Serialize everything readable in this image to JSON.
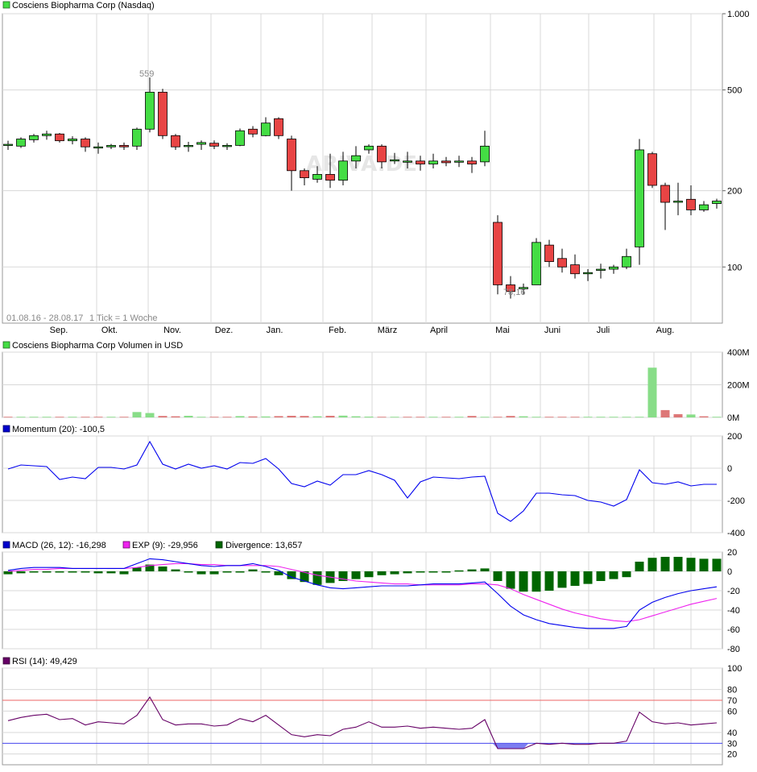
{
  "colors": {
    "up": "#44dd44",
    "down": "#e84444",
    "grid": "#d8d8d8",
    "momentum": "#0000ee",
    "macd": "#0000ee",
    "exp": "#ee22ee",
    "divergence": "#006600",
    "rsi": "#660066",
    "rsi_upper": "#ee6666",
    "rsi_lower": "#4444ee"
  },
  "header": {
    "price_title": "Cosciens Biopharma Corp (Nasdaq)",
    "volume_title": "Cosciens Biopharma Corp Volumen in USD"
  },
  "watermark": "ARIVA.DE",
  "price": {
    "range_label": "01.08.16 - 28.08.17",
    "tick_label": "1 Tick = 1 Woche",
    "high_annotation": "559",
    "low_annotation": "78,16",
    "y_ticks": [
      "1.000",
      "500",
      "200",
      "100"
    ],
    "x_months": [
      "Sep.",
      "Okt.",
      "Nov.",
      "Dez.",
      "Jan.",
      "Feb.",
      "März",
      "April",
      "Mai",
      "Juni",
      "Juli",
      "Aug."
    ]
  },
  "legends": {
    "momentum": {
      "label": "Momentum (20): -100,5"
    },
    "macd": {
      "label": "MACD (26, 12): -16,298"
    },
    "exp": {
      "label": "EXP (9): -29,956"
    },
    "divergence": {
      "label": "Divergence: 13,657"
    },
    "rsi": {
      "label": "RSI (14): 49,429"
    }
  },
  "chart_data": [
    {
      "type": "candlestick",
      "title": "Cosciens Biopharma Corp (Nasdaq)",
      "scale": "log",
      "ylim": [
        60,
        1000
      ],
      "y_ticks": [
        1000,
        500,
        200,
        100
      ],
      "candles": [
        [
          305,
          305,
          290,
          315
        ],
        [
          300,
          320,
          295,
          325
        ],
        [
          318,
          330,
          310,
          335
        ],
        [
          330,
          335,
          318,
          345
        ],
        [
          335,
          315,
          310,
          338
        ],
        [
          315,
          320,
          305,
          328
        ],
        [
          320,
          298,
          285,
          325
        ],
        [
          298,
          298,
          280,
          310
        ],
        [
          298,
          302,
          292,
          306
        ],
        [
          302,
          298,
          290,
          310
        ],
        [
          300,
          350,
          290,
          355
        ],
        [
          350,
          490,
          340,
          560
        ],
        [
          490,
          330,
          320,
          505
        ],
        [
          330,
          298,
          290,
          335
        ],
        [
          300,
          302,
          285,
          312
        ],
        [
          305,
          310,
          290,
          316
        ],
        [
          308,
          300,
          292,
          316
        ],
        [
          302,
          302,
          290,
          308
        ],
        [
          302,
          345,
          300,
          352
        ],
        [
          350,
          335,
          325,
          360
        ],
        [
          330,
          370,
          328,
          390
        ],
        [
          385,
          330,
          320,
          390
        ],
        [
          320,
          240,
          200,
          330
        ],
        [
          240,
          225,
          210,
          245
        ],
        [
          222,
          232,
          215,
          250
        ],
        [
          232,
          220,
          205,
          280
        ],
        [
          220,
          262,
          210,
          285
        ],
        [
          262,
          275,
          245,
          300
        ],
        [
          290,
          300,
          280,
          305
        ],
        [
          300,
          260,
          245,
          305
        ],
        [
          262,
          265,
          255,
          282
        ],
        [
          260,
          262,
          245,
          285
        ],
        [
          262,
          255,
          240,
          275
        ],
        [
          255,
          262,
          245,
          280
        ],
        [
          262,
          258,
          250,
          272
        ],
        [
          260,
          262,
          248,
          275
        ],
        [
          262,
          255,
          235,
          272
        ],
        [
          260,
          300,
          250,
          345
        ],
        [
          150,
          85,
          78,
          160
        ],
        [
          85,
          80,
          75,
          92
        ],
        [
          82,
          83,
          78,
          86
        ],
        [
          85,
          125,
          85,
          130
        ],
        [
          122,
          105,
          100,
          128
        ],
        [
          108,
          100,
          95,
          118
        ],
        [
          102,
          94,
          90,
          112
        ],
        [
          95,
          95,
          88,
          98
        ],
        [
          98,
          98,
          90,
          103
        ],
        [
          98,
          100,
          94,
          102
        ],
        [
          100,
          110,
          98,
          118
        ],
        [
          120,
          290,
          102,
          320
        ],
        [
          280,
          210,
          205,
          285
        ],
        [
          210,
          180,
          140,
          215
        ],
        [
          180,
          182,
          160,
          215
        ],
        [
          185,
          168,
          160,
          210
        ],
        [
          168,
          176,
          165,
          182
        ],
        [
          178,
          182,
          170,
          186
        ]
      ]
    },
    {
      "type": "bar",
      "title": "Cosciens Biopharma Corp Volumen in USD",
      "ylim": [
        0,
        400
      ],
      "unit": "M",
      "y_ticks": [
        "400M",
        "200M",
        "0M"
      ],
      "values": [
        1,
        1,
        1,
        1,
        1,
        1,
        1,
        1,
        1,
        1,
        33,
        27,
        9,
        7,
        10,
        2,
        2,
        3,
        8,
        6,
        6,
        8,
        10,
        9,
        7,
        10,
        11,
        7,
        5,
        3,
        3,
        2,
        2,
        2,
        2,
        2,
        9,
        2,
        1,
        9,
        7,
        3,
        3,
        3,
        2,
        2,
        2,
        2,
        2,
        1,
        305,
        45,
        20,
        18,
        7,
        3
      ],
      "up": [
        0,
        1,
        1,
        1,
        0,
        1,
        0,
        0,
        1,
        0,
        1,
        1,
        0,
        0,
        1,
        1,
        0,
        0,
        1,
        0,
        1,
        0,
        0,
        0,
        1,
        0,
        1,
        1,
        1,
        0,
        1,
        0,
        0,
        1,
        0,
        1,
        0,
        1,
        0,
        0,
        1,
        1,
        0,
        0,
        0,
        1,
        1,
        1,
        1,
        1,
        1,
        0,
        0,
        1,
        0,
        1
      ]
    },
    {
      "type": "line",
      "title": "Momentum (20): -100,5",
      "ylim": [
        -400,
        200
      ],
      "y_ticks": [
        200,
        0,
        -200,
        -400
      ],
      "series": [
        {
          "values": [
            -5,
            20,
            15,
            10,
            -70,
            -55,
            -65,
            5,
            5,
            -5,
            20,
            165,
            25,
            -5,
            25,
            0,
            15,
            -5,
            35,
            30,
            60,
            -5,
            -95,
            -115,
            -80,
            -105,
            -40,
            -40,
            -15,
            -40,
            -75,
            -185,
            -85,
            -55,
            -60,
            -65,
            -55,
            -50,
            -280,
            -330,
            -265,
            -155,
            -155,
            -165,
            -170,
            -200,
            -210,
            -235,
            -195,
            -10,
            -90,
            -100,
            -85,
            -110,
            -100,
            -100
          ]
        }
      ]
    },
    {
      "type": "line",
      "title": "MACD (26, 12): -16,298",
      "ylim": [
        -80,
        20
      ],
      "y_ticks": [
        20,
        0,
        -20,
        -40,
        -60,
        -80
      ],
      "series": [
        {
          "name": "MACD (26, 12): -16,298",
          "values": [
            1,
            3,
            4,
            4,
            4,
            3,
            3,
            3,
            3,
            3,
            8,
            13,
            12,
            10,
            8,
            6,
            5,
            6,
            6,
            8,
            5,
            1,
            -6,
            -10,
            -14,
            -17,
            -18,
            -17,
            -16,
            -15,
            -15,
            -15,
            -14,
            -13,
            -13,
            -13,
            -12,
            -11,
            -23,
            -36,
            -45,
            -50,
            -54,
            -56,
            -58,
            -59,
            -59,
            -59,
            -57,
            -40,
            -32,
            -27,
            -23,
            -20,
            -18,
            -16
          ]
        },
        {
          "name": "EXP (9): -29,956",
          "values": [
            0,
            1,
            2,
            2,
            3,
            3,
            3,
            3,
            3,
            3,
            4,
            6,
            7,
            8,
            8,
            7,
            7,
            6,
            6,
            6,
            6,
            5,
            2,
            -1,
            -4,
            -6,
            -8,
            -10,
            -11,
            -12,
            -13,
            -13,
            -14,
            -14,
            -14,
            -14,
            -13,
            -13,
            -14,
            -18,
            -24,
            -29,
            -34,
            -39,
            -43,
            -46,
            -49,
            -51,
            -52,
            -50,
            -46,
            -42,
            -38,
            -34,
            -31,
            -28
          ]
        },
        {
          "name": "Divergence: 13,657",
          "values": [
            -3,
            -2,
            -1,
            -1,
            -1,
            -1,
            -1,
            -2,
            -2,
            -3,
            4,
            7,
            5,
            2,
            -1,
            -3,
            -3,
            -1,
            0,
            2,
            -1,
            -4,
            -8,
            -11,
            -14,
            -12,
            -10,
            -8,
            -6,
            -4,
            -3,
            -2,
            -1,
            -1,
            0,
            1,
            2,
            3,
            -10,
            -18,
            -21,
            -21,
            -20,
            -17,
            -15,
            -13,
            -10,
            -8,
            -6,
            10,
            14,
            15,
            15,
            14,
            13,
            13
          ]
        }
      ]
    },
    {
      "type": "line",
      "title": "RSI (14): 49,429",
      "ylim": [
        10,
        100
      ],
      "y_ticks": [
        100,
        80,
        70,
        60,
        40,
        30,
        20
      ],
      "series": [
        {
          "values": [
            51,
            54,
            56,
            57,
            52,
            53,
            47,
            50,
            49,
            48,
            56,
            73,
            52,
            47,
            48,
            48,
            46,
            47,
            53,
            50,
            56,
            47,
            38,
            36,
            38,
            37,
            43,
            45,
            50,
            45,
            45,
            46,
            44,
            45,
            44,
            43,
            44,
            52,
            25,
            25,
            25,
            30,
            29,
            30,
            29,
            29,
            30,
            30,
            32,
            59,
            50,
            48,
            49,
            47,
            48,
            49
          ]
        }
      ]
    }
  ]
}
